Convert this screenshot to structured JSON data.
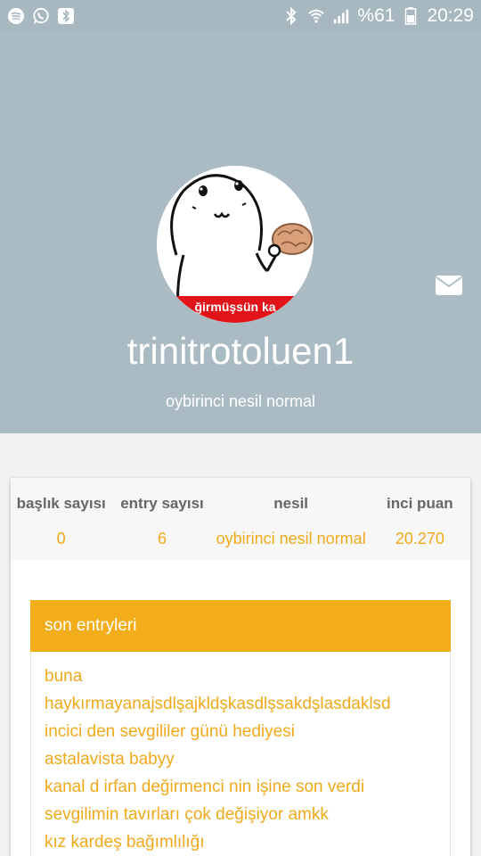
{
  "status_bar": {
    "battery": "%61",
    "time": "20:29"
  },
  "profile": {
    "username": "trinitrotoluen1",
    "generation": "oybirinci nesil normal",
    "avatar_caption": "ğirmüşsün ka"
  },
  "stats": [
    {
      "label": "başlık sayısı",
      "value": "0"
    },
    {
      "label": "entry sayısı",
      "value": "6"
    },
    {
      "label": "nesil",
      "value": "oybirinci nesil normal"
    },
    {
      "label": "inci puan",
      "value": "20.270"
    }
  ],
  "recent": {
    "title": "son entryleri",
    "entries": [
      "buna",
      "haykırmayanajsdlşajkldşkasdlşsakdşlasdaklsd",
      "incici den sevgililer günü hediyesi",
      "astalavista babyy",
      "kanal d irfan değirmenci nin işine son verdi",
      "sevgilimin tavırları çok değişiyor amkk",
      "kız kardeş bağımlılığı"
    ]
  },
  "colors": {
    "header_bg": "#aabbc3",
    "accent": "#f3ad1b",
    "link": "#f0a91c"
  }
}
